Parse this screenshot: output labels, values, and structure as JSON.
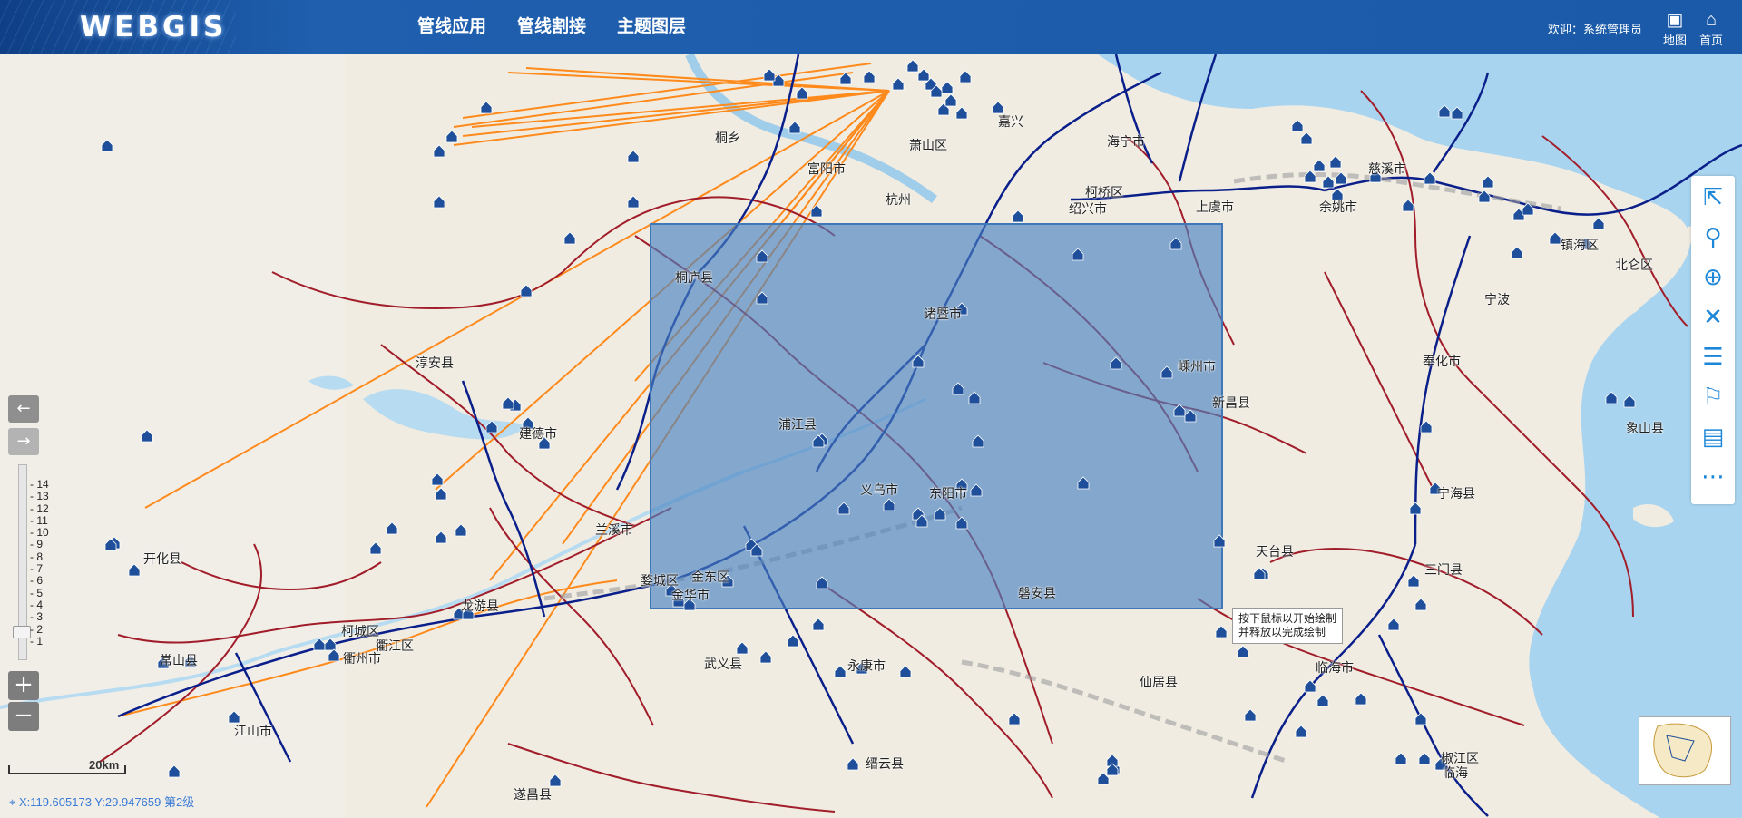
{
  "header": {
    "logo": "WEBGIS",
    "menu": [
      "管线应用",
      "管线割接",
      "主题图层"
    ],
    "welcome": "欢迎：系统管理员",
    "buttons": [
      {
        "label": "地图",
        "icon": "map-icon"
      },
      {
        "label": "首页",
        "icon": "home-icon"
      }
    ]
  },
  "map": {
    "place_labels": [
      "富阳市",
      "桐庐县",
      "淳安县",
      "建德市",
      "兰溪市",
      "开化县",
      "常山县",
      "柯城区",
      "衢江区",
      "衢州市",
      "龙游县",
      "江山市",
      "浦江县",
      "义乌市",
      "东阳市",
      "诸暨市",
      "嵊州市",
      "新昌县",
      "磐安县",
      "上虞市",
      "余姚市",
      "镇海区",
      "北仑区",
      "奉化市",
      "象山县",
      "宁海县",
      "天台县",
      "三门县",
      "临海市",
      "仙居县",
      "武义县",
      "永康市",
      "缙云县",
      "遂昌县",
      "椒江区",
      "临海",
      "婺城区",
      "金东区",
      "金华市",
      "柯桥区",
      "绍兴市",
      "萧山区",
      "桐乡",
      "海宁市",
      "嘉兴",
      "慈溪市",
      "杭州",
      "宁波"
    ],
    "colors": {
      "map_bg": "#f2efe6",
      "water": "#a9d4ef",
      "selection": "#4a83c2",
      "pipe_blue": "#0a1f8a",
      "pipe_red": "#a11d2a",
      "pipe_orange": "#ff8a1c",
      "marker": "#1f4f9a"
    },
    "scale_label": "20km",
    "coordinate_text": "X:119.605173 Y:29.947659 第2级",
    "zoom_levels": [
      "14",
      "13",
      "12",
      "11",
      "10",
      "9",
      "8",
      "7",
      "6",
      "5",
      "4",
      "3",
      "2",
      "1"
    ],
    "zoom_current": 2,
    "tooltip": "按下鼠标以开始绘制并释放以完成绘制"
  },
  "controls": {
    "pan_left": "←",
    "pan_right": "→",
    "zoom_in": "+",
    "zoom_out": "−",
    "toolbar": [
      "select-icon",
      "search-icon",
      "zoom-in-icon",
      "close-icon",
      "layers-icon",
      "bookmark-icon",
      "clear-icon",
      "more-icon"
    ]
  }
}
